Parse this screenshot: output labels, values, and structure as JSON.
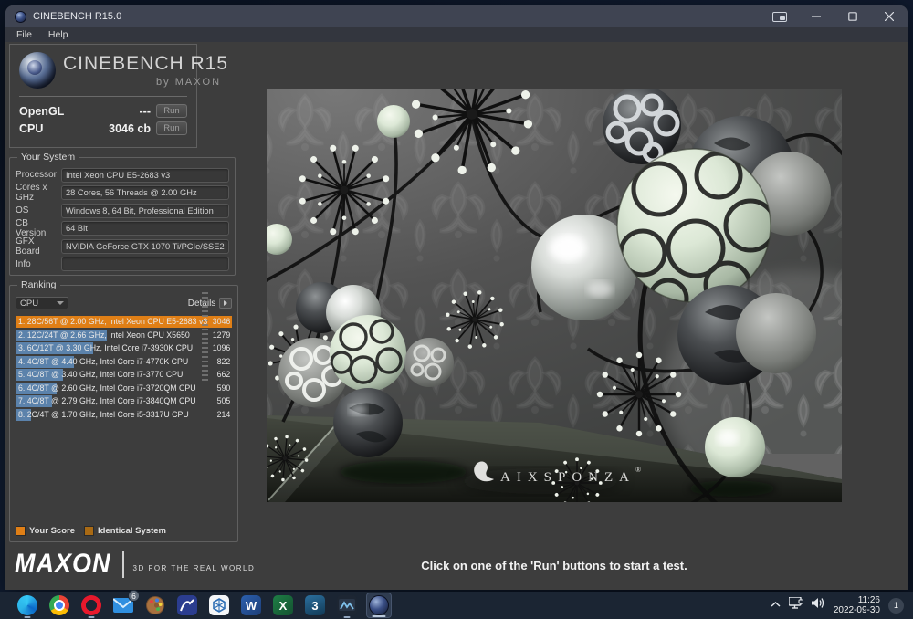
{
  "window": {
    "title": "CINEBENCH R15.0",
    "menu": {
      "file": "File",
      "help": "Help"
    }
  },
  "logo": {
    "title": "CINEBENCH R15",
    "subtitle": "by MAXON"
  },
  "benchmarks": {
    "opengl": {
      "label": "OpenGL",
      "value": "---",
      "run_label": "Run"
    },
    "cpu": {
      "label": "CPU",
      "value": "3046 cb",
      "run_label": "Run"
    }
  },
  "your_system": {
    "legend": "Your System",
    "fields": [
      {
        "label": "Processor",
        "value": "Intel Xeon CPU E5-2683 v3"
      },
      {
        "label": "Cores x GHz",
        "value": "28 Cores, 56 Threads @ 2.00 GHz"
      },
      {
        "label": "OS",
        "value": "Windows 8, 64 Bit, Professional Edition"
      },
      {
        "label": "CB Version",
        "value": "64 Bit"
      },
      {
        "label": "GFX Board",
        "value": "NVIDIA GeForce GTX 1070 Ti/PCIe/SSE2"
      },
      {
        "label": "Info",
        "value": ""
      }
    ]
  },
  "ranking": {
    "legend": "Ranking",
    "filter_value": "CPU",
    "details_label": "Details",
    "rows": [
      {
        "label": "1. 28C/56T @ 2.00 GHz, Intel Xeon CPU E5-2683 v3",
        "score": "3046",
        "bar_pct": 100,
        "type": "self"
      },
      {
        "label": "2. 12C/24T @ 2.66 GHz, Intel Xeon CPU X5650",
        "score": "1279",
        "bar_pct": 42,
        "type": "other"
      },
      {
        "label": "3. 6C/12T @ 3.30 GHz, Intel Core i7-3930K CPU",
        "score": "1096",
        "bar_pct": 36,
        "type": "other"
      },
      {
        "label": "4. 4C/8T @ 4.40 GHz, Intel Core i7-4770K CPU",
        "score": "822",
        "bar_pct": 27,
        "type": "other"
      },
      {
        "label": "5. 4C/8T @ 3.40 GHz, Intel Core i7-3770 CPU",
        "score": "662",
        "bar_pct": 22,
        "type": "other"
      },
      {
        "label": "6. 4C/8T @ 2.60 GHz, Intel Core i7-3720QM CPU",
        "score": "590",
        "bar_pct": 19,
        "type": "other"
      },
      {
        "label": "7. 4C/8T @ 2.79 GHz, Intel Core i7-3840QM CPU",
        "score": "505",
        "bar_pct": 17,
        "type": "other"
      },
      {
        "label": "8. 2C/4T @ 1.70 GHz, Intel Core i5-3317U CPU",
        "score": "214",
        "bar_pct": 7,
        "type": "other"
      }
    ],
    "legend_items": [
      {
        "label": "Your Score",
        "color": "#e07f16"
      },
      {
        "label": "Identical System",
        "color": "#a96a14"
      }
    ]
  },
  "colors": {
    "self_bar": "#e07f16",
    "other_bar": "#5b82ab"
  },
  "footer": {
    "brand": "MAXON",
    "tagline": "3D FOR THE REAL WORLD"
  },
  "viewport": {
    "watermark": "AIXSPONZA",
    "watermark_reg": "®"
  },
  "hint_text": "Click on one of the 'Run' buttons to start a test.",
  "taskbar": {
    "mail_badge": "6",
    "tray": {
      "time": "11:26",
      "date": "2022-09-30",
      "badge": "1"
    }
  }
}
